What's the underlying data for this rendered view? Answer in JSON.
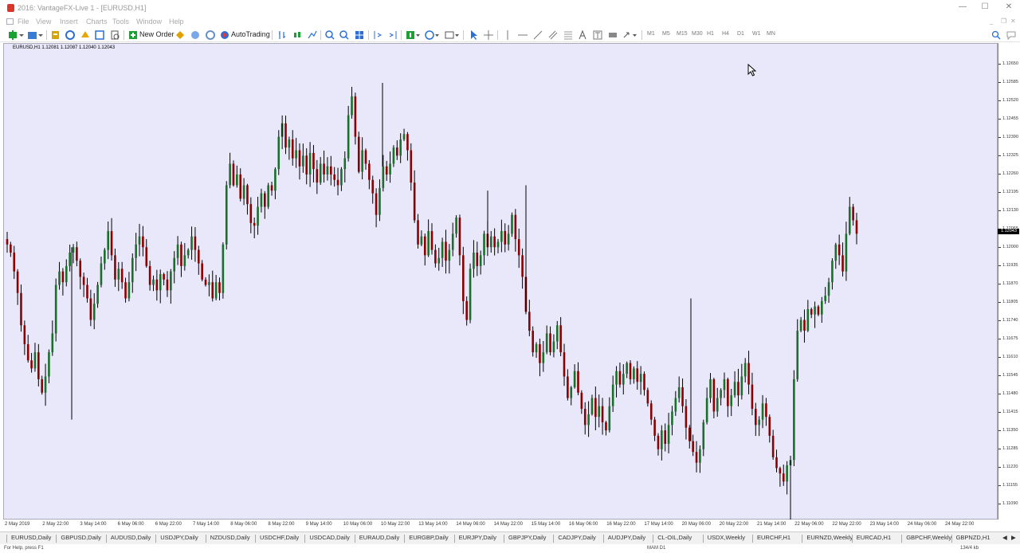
{
  "window": {
    "title": "2016: VantageFX-Live 1 - [EURUSD,H1]",
    "minimize_glyph": "—",
    "maximize_glyph": "☐",
    "close_glyph": "✕"
  },
  "menu": {
    "items": [
      "File",
      "View",
      "Insert",
      "Charts",
      "Tools",
      "Window",
      "Help"
    ],
    "mdi_min": "_",
    "mdi_restore": "❐",
    "mdi_close": "✕"
  },
  "toolbar": {
    "new_order_label": "New Order",
    "autotrading_label": "AutoTrading",
    "timeframes": [
      "M1",
      "M5",
      "M15",
      "M30",
      "H1",
      "H4",
      "D1",
      "W1",
      "MN"
    ],
    "icons": [
      "new-chart-icon",
      "profiles-icon",
      "market-watch-icon",
      "navigator-icon",
      "terminal-icon",
      "strategy-tester-icon",
      "metaeditor-icon",
      "signals-icon",
      "bar-chart-icon",
      "candlestick-icon",
      "line-chart-icon",
      "zoom-in-icon",
      "zoom-out-icon",
      "tile-windows-icon",
      "chart-shift-icon",
      "autoscroll-icon",
      "indicators-icon",
      "periods-icon",
      "templates-icon",
      "cursor-icon",
      "crosshair-icon",
      "vertical-line-icon",
      "horizontal-line-icon",
      "trendline-icon",
      "channel-icon",
      "fibonacci-icon",
      "text-icon",
      "text-label-icon",
      "arrows-icon",
      "search-icon",
      "chat-icon"
    ],
    "accent_green": "#1aa033",
    "accent_blue": "#2b6fd6"
  },
  "chart": {
    "info_label": "EURUSD,H1  1.12081 1.12087 1.12040 1.12043",
    "background": "#e8e8fa",
    "bull_color": "#1a6f2a",
    "bear_color": "#8b0000",
    "wick_color": "#000000",
    "current_price_label": "1.12043"
  },
  "chart_data": {
    "type": "candlestick",
    "symbol": "EURUSD",
    "timeframe": "H1",
    "ylim": [
      1.1105,
      1.1268
    ],
    "y_ticks": [
      "1.12650",
      "1.12585",
      "1.12520",
      "1.12455",
      "1.12390",
      "1.12325",
      "1.12260",
      "1.12195",
      "1.12130",
      "1.12065",
      "1.12000",
      "1.11935",
      "1.11870",
      "1.11805",
      "1.11740",
      "1.11675",
      "1.11610",
      "1.11545",
      "1.11480",
      "1.11415",
      "1.11350",
      "1.11285",
      "1.11220",
      "1.11155",
      "1.11090",
      "1.11025"
    ],
    "x_ticks": [
      "2 May 2019",
      "2 May 22:00",
      "3 May 14:00",
      "6 May 06:00",
      "6 May 22:00",
      "7 May 14:00",
      "8 May 06:00",
      "8 May 22:00",
      "9 May 14:00",
      "10 May 06:00",
      "10 May 22:00",
      "13 May 14:00",
      "14 May 06:00",
      "14 May 22:00",
      "15 May 14:00",
      "16 May 06:00",
      "16 May 22:00",
      "17 May 14:00",
      "20 May 06:00",
      "20 May 22:00",
      "21 May 14:00",
      "22 May 06:00",
      "22 May 22:00",
      "23 May 14:00",
      "24 May 06:00",
      "24 May 22:00"
    ],
    "path_close": [
      1.12,
      1.1197,
      1.119,
      1.1182,
      1.117,
      1.1163,
      1.1157,
      1.1154,
      1.116,
      1.115,
      1.1145,
      1.1151,
      1.116,
      1.1167,
      1.1185,
      1.119,
      1.1186,
      1.1192,
      1.1197,
      1.1199,
      1.1194,
      1.1188,
      1.1185,
      1.118,
      1.1172,
      1.1178,
      1.1185,
      1.1193,
      1.1198,
      1.1205,
      1.1196,
      1.1187,
      1.1191,
      1.1186,
      1.118,
      1.1186,
      1.1195,
      1.12,
      1.1203,
      1.1199,
      1.1192,
      1.1185,
      1.1187,
      1.1183,
      1.1189,
      1.1187,
      1.1183,
      1.119,
      1.1195,
      1.12,
      1.1192,
      1.1196,
      1.1198,
      1.1203,
      1.1198,
      1.1193,
      1.1187,
      1.1185,
      1.1186,
      1.118,
      1.1186,
      1.1182,
      1.12,
      1.1222,
      1.123,
      1.1222,
      1.1226,
      1.1217,
      1.1222,
      1.1215,
      1.1208,
      1.1207,
      1.1214,
      1.1219,
      1.1214,
      1.1222,
      1.122,
      1.1228,
      1.124,
      1.1245,
      1.1236,
      1.1239,
      1.1232,
      1.1235,
      1.1229,
      1.1233,
      1.1226,
      1.1234,
      1.1228,
      1.1223,
      1.123,
      1.1226,
      1.1229,
      1.1226,
      1.1224,
      1.1222,
      1.1228,
      1.1232,
      1.1248,
      1.1255,
      1.124,
      1.1227,
      1.1235,
      1.123,
      1.1224,
      1.1219,
      1.1211,
      1.1221,
      1.1229,
      1.1226,
      1.123,
      1.1236,
      1.1233,
      1.1239,
      1.1241,
      1.1235,
      1.1223,
      1.1209,
      1.12,
      1.1203,
      1.1196,
      1.1205,
      1.1198,
      1.1193,
      1.1195,
      1.1201,
      1.1194,
      1.1198,
      1.1204,
      1.121,
      1.1196,
      1.1179,
      1.1172,
      1.1191,
      1.1197,
      1.1192,
      1.1196,
      1.1204,
      1.1199,
      1.1203,
      1.1199,
      1.1201,
      1.1205,
      1.12,
      1.1204,
      1.1211,
      1.1202,
      1.1196,
      1.1188,
      1.1175,
      1.1168,
      1.116,
      1.1163,
      1.1156,
      1.116,
      1.1167,
      1.116,
      1.1164,
      1.117,
      1.116,
      1.1151,
      1.1143,
      1.1147,
      1.1153,
      1.1145,
      1.1139,
      1.1133,
      1.1137,
      1.1143,
      1.1136,
      1.114,
      1.1134,
      1.1131,
      1.114,
      1.1148,
      1.1153,
      1.1148,
      1.1152,
      1.1156,
      1.115,
      1.1154,
      1.1149,
      1.1152,
      1.1146,
      1.1141,
      1.1135,
      1.1129,
      1.1124,
      1.1131,
      1.1126,
      1.1133,
      1.1138,
      1.1143,
      1.1147,
      1.114,
      1.1132,
      1.1127,
      1.1123,
      1.1119,
      1.1124,
      1.1134,
      1.1143,
      1.115,
      1.1138,
      1.1143,
      1.1146,
      1.115,
      1.114,
      1.1144,
      1.1149,
      1.1144,
      1.1151,
      1.1156,
      1.1148,
      1.1139,
      1.1133,
      1.1135,
      1.1141,
      1.1136,
      1.1129,
      1.1121,
      1.1117,
      1.1115,
      1.1112,
      1.1118,
      1.112,
      1.115,
      1.1168,
      1.1172,
      1.1168,
      1.1176,
      1.1174,
      1.1177,
      1.1174,
      1.1179,
      1.1181,
      1.1186,
      1.1194,
      1.12,
      1.1196,
      1.119,
      1.1204,
      1.1214,
      1.1209,
      1.1204
    ],
    "spikes": [
      [
        90,
        1.1135
      ],
      [
        354,
        1.124
      ],
      [
        480,
        1.126
      ],
      [
        612,
        1.122
      ],
      [
        660,
        1.1222
      ],
      [
        867,
        1.118
      ],
      [
        992,
        1.1095
      ]
    ]
  },
  "cursor": {
    "icon": "mouse-pointer-icon"
  },
  "tabs": [
    "EURUSD,Daily",
    "GBPUSD,Daily",
    "AUDUSD,Daily",
    "USDJPY,Daily",
    "NZDUSD,Daily",
    "USDCHF,Daily",
    "USDCAD,Daily",
    "EURAUD,Daily",
    "EURGBP,Daily",
    "EURJPY,Daily",
    "GBPJPY,Daily",
    "CADJPY,Daily",
    "AUDJPY,Daily",
    "CL-OIL,Daily",
    "USDX,Weekly",
    "EURCHF,H1",
    "EURNZD,Weekly",
    "EURCAD,H1",
    "GBPCHF,Weekly",
    "GBPNZD,H1"
  ],
  "tab_arrows": [
    "◀",
    "▶"
  ],
  "status": {
    "help_text": "For Help, press F1",
    "profile": "MAM D1",
    "traffic": "134/4 kb"
  }
}
